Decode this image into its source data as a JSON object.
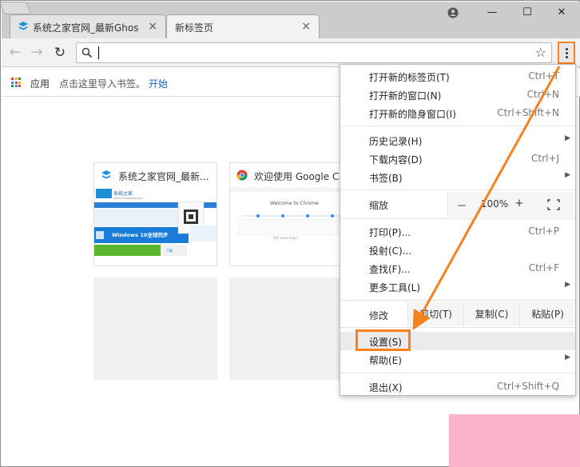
{
  "tabs": [
    {
      "title": "系统之家官网_最新Ghos",
      "close": "×"
    },
    {
      "title": "新标签页",
      "close": "×"
    }
  ],
  "window_controls": {
    "user_icon": "user-circle-icon",
    "minimize": "—",
    "maximize": "☐",
    "close": "✕"
  },
  "toolbar": {
    "back": "←",
    "forward": "→",
    "reload": "↻",
    "omnibox_value": "",
    "star": "☆"
  },
  "bookmarks_bar": {
    "apps_label": "应用",
    "hint": "点击这里导入书签。",
    "start_link": "开始"
  },
  "tiles": [
    {
      "title": "系统之家官网_最新..."
    },
    {
      "title": "欢迎使用 Google C..."
    }
  ],
  "tile_previews": {
    "tile1": {
      "logo": "系统之家",
      "logo_sub": "WWW.XITONGZHIJIA.NET",
      "banner": "Windows 10全球同步",
      "button": "下载"
    },
    "tile2": {
      "welcome": "Welcome to Chrome",
      "search": "Still need help?"
    }
  },
  "menu": {
    "new_tab": {
      "label": "打开新的标签页(T)",
      "accel": "Ctrl+T"
    },
    "new_window": {
      "label": "打开新的窗口(N)",
      "accel": "Ctrl+N"
    },
    "incognito": {
      "label": "打开新的隐身窗口(I)",
      "accel": "Ctrl+Shift+N"
    },
    "history": {
      "label": "历史记录(H)"
    },
    "downloads": {
      "label": "下载内容(D)",
      "accel": "Ctrl+J"
    },
    "bookmarks": {
      "label": "书签(B)"
    },
    "zoom": {
      "label": "缩放",
      "minus": "－",
      "value": "100%",
      "plus": "+"
    },
    "print": {
      "label": "打印(P)...",
      "accel": "Ctrl+P"
    },
    "cast": {
      "label": "投射(C)..."
    },
    "find": {
      "label": "查找(F)...",
      "accel": "Ctrl+F"
    },
    "more_tools": {
      "label": "更多工具(L)"
    },
    "edit": {
      "label": "修改",
      "cut": "剪切(T)",
      "copy": "复制(C)",
      "paste": "粘贴(P)"
    },
    "settings": {
      "label": "设置(S)"
    },
    "help": {
      "label": "帮助(E)"
    },
    "exit": {
      "label": "退出(X)",
      "accel": "Ctrl+Shift+Q"
    }
  },
  "colors": {
    "annotation": "#f5821f",
    "link": "#1a66c7",
    "corner_patch": "#fcb4cb"
  }
}
